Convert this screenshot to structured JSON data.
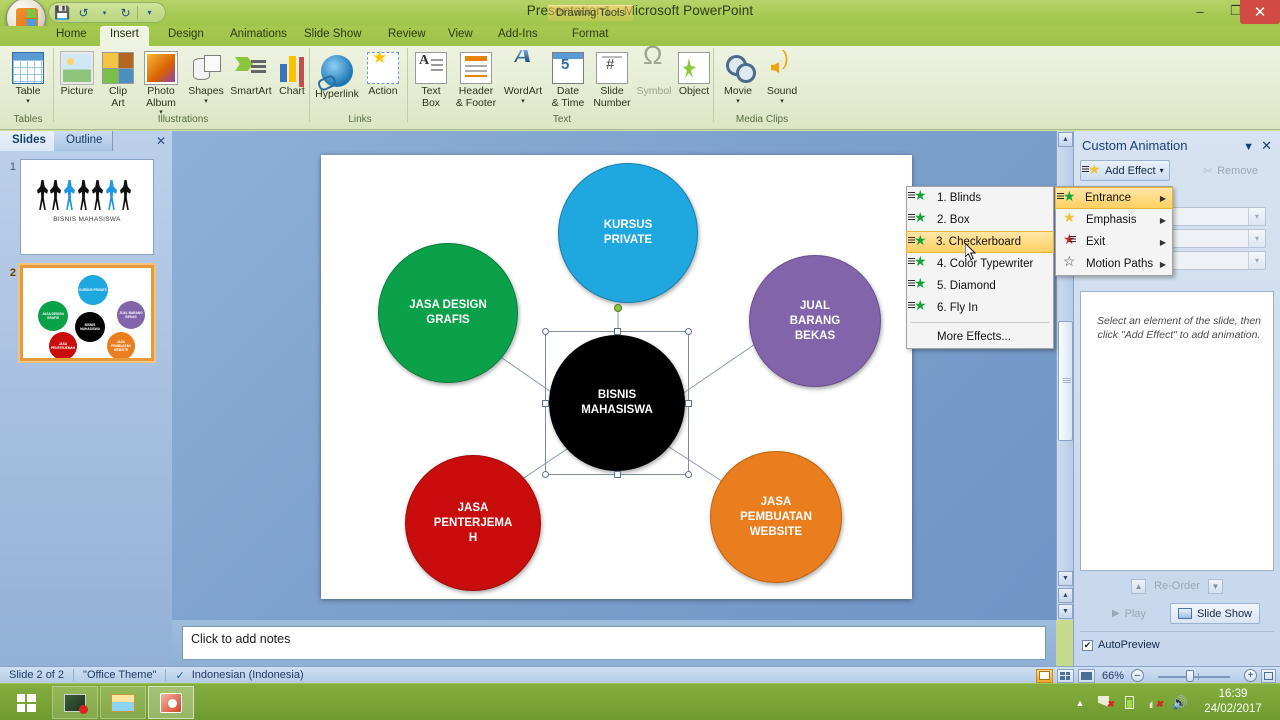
{
  "window": {
    "title": "Presentation1 - Microsoft PowerPoint",
    "contextual_tab_title": "Drawing Tools",
    "minimize": "–",
    "maximize": "❐",
    "close": "✕"
  },
  "quick_access": {
    "save": "save-icon",
    "undo": "undo-icon",
    "redo": "redo-icon",
    "customize": "▾"
  },
  "tabs": [
    {
      "label": "Home",
      "active": false
    },
    {
      "label": "Insert",
      "active": true
    },
    {
      "label": "Design",
      "active": false
    },
    {
      "label": "Animations",
      "active": false
    },
    {
      "label": "Slide Show",
      "active": false
    },
    {
      "label": "Review",
      "active": false
    },
    {
      "label": "View",
      "active": false
    },
    {
      "label": "Add-Ins",
      "active": false
    },
    {
      "label": "Format",
      "active": false
    }
  ],
  "ribbon": {
    "groups": [
      {
        "name": "Tables",
        "label": "Tables",
        "buttons": [
          {
            "label": "Table",
            "arrow": "▾",
            "icon": "table-icon",
            "dim": false
          }
        ]
      },
      {
        "name": "Illustrations",
        "label": "Illustrations",
        "buttons": [
          {
            "label": "Picture",
            "arrow": "",
            "icon": "picture-icon",
            "dim": false
          },
          {
            "label": "Clip\nArt",
            "arrow": "",
            "icon": "clip-art-icon",
            "dim": false
          },
          {
            "label": "Photo\nAlbum",
            "arrow": "▾",
            "icon": "photo-album-icon",
            "dim": false
          },
          {
            "label": "Shapes",
            "arrow": "▾",
            "icon": "shapes-icon",
            "dim": false
          },
          {
            "label": "SmartArt",
            "arrow": "",
            "icon": "smartart-icon",
            "dim": false
          },
          {
            "label": "Chart",
            "arrow": "",
            "icon": "chart-icon",
            "dim": false
          }
        ]
      },
      {
        "name": "Links",
        "label": "Links",
        "buttons": [
          {
            "label": "Hyperlink",
            "arrow": "",
            "icon": "hyperlink-icon",
            "dim": false
          },
          {
            "label": "Action",
            "arrow": "",
            "icon": "action-icon",
            "dim": false
          }
        ]
      },
      {
        "name": "Text",
        "label": "Text",
        "buttons": [
          {
            "label": "Text\nBox",
            "arrow": "",
            "icon": "text-box-icon",
            "dim": false
          },
          {
            "label": "Header\n& Footer",
            "arrow": "",
            "icon": "header-footer-icon",
            "dim": false
          },
          {
            "label": "WordArt",
            "arrow": "▾",
            "icon": "wordart-icon",
            "dim": false
          },
          {
            "label": "Date\n& Time",
            "arrow": "",
            "icon": "date-time-icon",
            "dim": false
          },
          {
            "label": "Slide\nNumber",
            "arrow": "",
            "icon": "slide-number-icon",
            "dim": false
          },
          {
            "label": "Symbol",
            "arrow": "",
            "icon": "symbol-icon",
            "dim": true
          },
          {
            "label": "Object",
            "arrow": "",
            "icon": "object-icon",
            "dim": false
          }
        ]
      },
      {
        "name": "Media Clips",
        "label": "Media Clips",
        "buttons": [
          {
            "label": "Movie",
            "arrow": "▾",
            "icon": "movie-icon",
            "dim": false
          },
          {
            "label": "Sound",
            "arrow": "▾",
            "icon": "sound-icon",
            "dim": false
          }
        ]
      }
    ]
  },
  "left_pane": {
    "tabs": [
      {
        "label": "Slides",
        "active": true
      },
      {
        "label": "Outline",
        "active": false
      }
    ],
    "close": "✕",
    "slides": [
      {
        "number": "1",
        "title": "BISNIS MAHASISWA",
        "selected": false
      },
      {
        "number": "2",
        "title": "",
        "selected": true
      }
    ]
  },
  "slide": {
    "center": {
      "label": "BISNIS\nMAHASISWA",
      "color": "#000000",
      "selected": true
    },
    "nodes": [
      {
        "label": "KURSUS\nPRIVATE",
        "color": "#1fa8e0"
      },
      {
        "label": "JASA DESIGN\nGRAFIS",
        "color": "#0ba14b"
      },
      {
        "label": "JUAL\nBARANG\nBEKAS",
        "color": "#8264ab"
      },
      {
        "label": "JASA\nPEMBUATAN\nWEBSITE",
        "color": "#ea7d1e"
      },
      {
        "label": "JASA\nPENTERJEMA\nH",
        "color": "#c90d0d"
      }
    ]
  },
  "notes": {
    "placeholder": "Click to add notes"
  },
  "animation_pane": {
    "title": "Custom Animation",
    "dropdown_icon": "▼",
    "close_icon": "✕",
    "add_effect_label": "Add Effect",
    "add_effect_arrow": "▾",
    "remove_label": "Remove",
    "hint": "Select an element of the slide, then click \"Add Effect\" to add animation.",
    "reorder_label": "Re-Order",
    "reorder_up": "▲",
    "reorder_down": "▼",
    "play_label": "Play",
    "play_icon": "▶",
    "slide_show_label": "Slide Show",
    "autopreview_label": "AutoPreview",
    "autopreview_checked": "✔"
  },
  "menus": {
    "add_effect": {
      "items": [
        {
          "label": "Entrance",
          "accel": "E",
          "icon": "entrance-star-icon",
          "submenu": "▶",
          "highlighted": true
        },
        {
          "label": "Emphasis",
          "accel": "M",
          "icon": "emphasis-star-icon",
          "submenu": "▶",
          "highlighted": false
        },
        {
          "label": "Exit",
          "accel": "X",
          "icon": "exit-star-icon",
          "submenu": "▶",
          "highlighted": false
        },
        {
          "label": "Motion Paths",
          "accel": "P",
          "icon": "motion-path-star-icon",
          "submenu": "▶",
          "highlighted": false
        }
      ]
    },
    "entrance_effects": {
      "items": [
        {
          "label": "1. Blinds",
          "icon": "effect-star-icon",
          "highlighted": false
        },
        {
          "label": "2. Box",
          "icon": "effect-star-icon",
          "highlighted": false
        },
        {
          "label": "3. Checkerboard",
          "icon": "effect-star-icon",
          "highlighted": true
        },
        {
          "label": "4. Color Typewriter",
          "icon": "effect-star-icon",
          "highlighted": false
        },
        {
          "label": "5. Diamond",
          "icon": "effect-star-icon",
          "highlighted": false
        },
        {
          "label": "6. Fly In",
          "icon": "effect-star-icon",
          "highlighted": false
        }
      ],
      "more": "More Effects..."
    }
  },
  "status_bar": {
    "slide_count": "Slide 2 of 2",
    "theme": "\"Office Theme\"",
    "language": "Indonesian (Indonesia)",
    "spellcheck_icon": "spellcheck-icon",
    "zoom_level": "66%",
    "zoom_out": "–",
    "zoom_in": "+",
    "fit_icon": "fit-to-window-icon",
    "views": [
      {
        "name": "normal-view",
        "active": true
      },
      {
        "name": "slide-sorter-view",
        "active": false
      },
      {
        "name": "slide-show-view",
        "active": false
      }
    ]
  },
  "taskbar": {
    "start": "start-button",
    "apps": [
      {
        "name": "screen-recorder-app",
        "active": false
      },
      {
        "name": "file-explorer-app",
        "active": false
      },
      {
        "name": "powerpoint-app",
        "active": true
      }
    ],
    "tray": [
      "show-hidden-icon",
      "network-icon",
      "battery-icon",
      "volume-muted-icon",
      "speaker-icon"
    ],
    "time": "16:39",
    "date": "24/02/2017"
  }
}
